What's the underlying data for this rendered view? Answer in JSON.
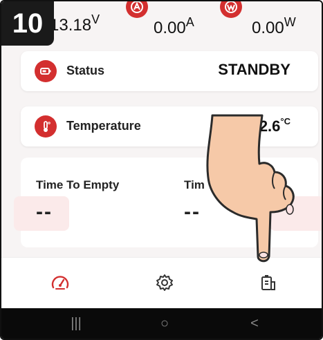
{
  "step_badge": "10",
  "metrics": {
    "voltage": {
      "value": "13.18",
      "unit": "V",
      "icon": "voltage-icon"
    },
    "current": {
      "value": "0.00",
      "unit": "A",
      "icon": "ampere-icon"
    },
    "power": {
      "value": "0.00",
      "unit": "W",
      "icon": "power-icon"
    }
  },
  "status": {
    "label": "Status",
    "value": "STANDBY",
    "icon": "battery-icon"
  },
  "temperature": {
    "label": "Temperature",
    "value": "22.6",
    "unit": "°C",
    "icon": "thermometer-icon"
  },
  "time": {
    "empty_label": "Time To Empty",
    "empty_value": "--",
    "full_label": "Tim",
    "full_value": "--"
  },
  "nav": {
    "items": [
      {
        "name": "dashboard",
        "icon": "speedometer-icon",
        "active": true
      },
      {
        "name": "settings",
        "icon": "gear-icon",
        "active": false
      },
      {
        "name": "battery-info",
        "icon": "battery-info-icon",
        "active": false
      }
    ]
  },
  "system_nav": {
    "recents": "|||",
    "home": "○",
    "back": "<"
  },
  "colors": {
    "accent": "#d32f2f",
    "background": "#f7f4f4",
    "card": "#ffffff",
    "system_bar": "#0a0a0a"
  }
}
